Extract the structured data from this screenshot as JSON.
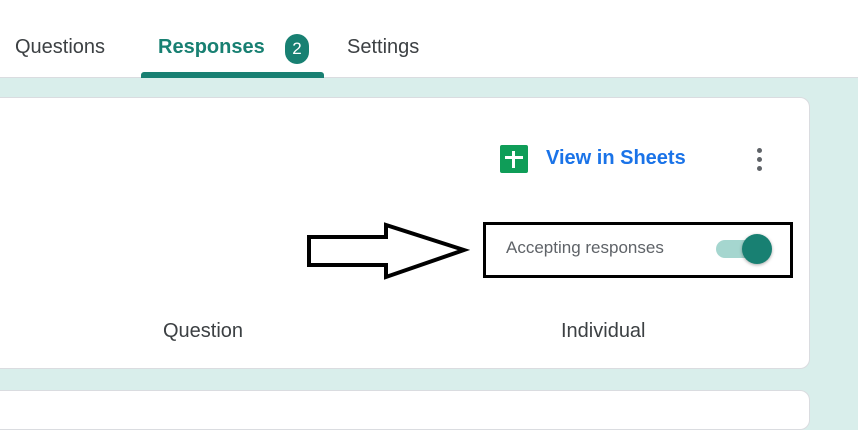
{
  "tabs": {
    "questions_label": "Questions",
    "responses_label": "Responses",
    "responses_count": "2",
    "settings_label": "Settings"
  },
  "card": {
    "view_in_sheets_label": "View in Sheets",
    "accepting_responses_label": "Accepting responses",
    "accepting_responses_on": true,
    "columns": [
      "Question",
      "Individual"
    ]
  },
  "icons": {
    "sheets": "sheets-icon",
    "more": "more-vert-icon",
    "annotation_arrow": "arrow-right-icon"
  },
  "colors": {
    "accent": "#188072",
    "link": "#1a73e8",
    "background": "#d9eeeb",
    "sheets_green": "#0f9d58",
    "toggle_track": "#a5d6cf"
  }
}
